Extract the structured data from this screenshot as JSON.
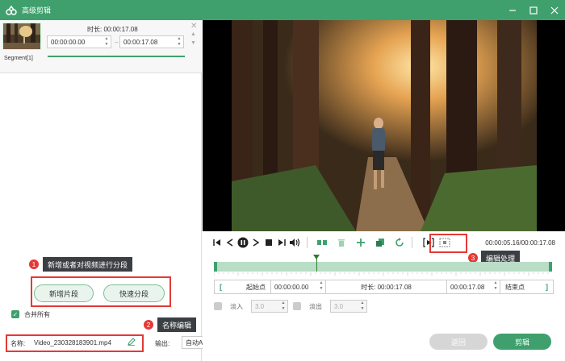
{
  "window": {
    "title": "高级剪辑",
    "accent": "#3fa06d"
  },
  "segment": {
    "duration_label": "时长: 00:00:17.08",
    "start_time": "00:00:00.00",
    "end_time": "00:00:17.08",
    "name": "Segment[1]",
    "dash": "–"
  },
  "annotations": {
    "a1_num": "1",
    "a1_text": "新增或者对视频进行分段",
    "a2_num": "2",
    "a2_text": "名称编辑",
    "a3_num": "3",
    "a3_text": "编辑处理"
  },
  "actions": {
    "add_segment": "新增片段",
    "quick_split": "快速分段",
    "merge_all": "合并所有"
  },
  "file": {
    "name_label": "名称:",
    "filename": "Video_230328183901.mp4",
    "output_label": "输出:",
    "output_value": "自动Auto"
  },
  "player": {
    "time_display": "00:00:05.16/00:00:17.08",
    "playhead_fraction": 0.302
  },
  "edit": {
    "start_label": "起始点",
    "start_time": "00:00:00.00",
    "duration_label": "时长: 00:00:17.08",
    "end_time": "00:00:17.08",
    "end_label": "结束点",
    "bracket_left": "[",
    "bracket_right": "]"
  },
  "fade": {
    "fade_in_label": "淡入",
    "fade_in_value": "3.0",
    "fade_out_label": "淡出",
    "fade_out_value": "3.0"
  },
  "footer": {
    "return_label": "返回",
    "clip_label": "剪辑"
  }
}
